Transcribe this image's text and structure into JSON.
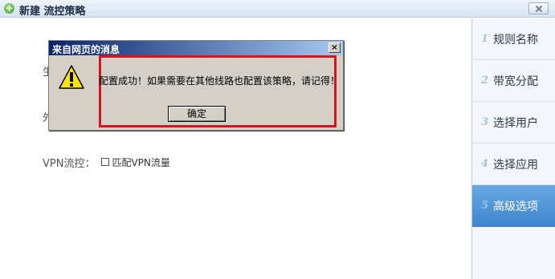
{
  "window": {
    "title": "新建 流控策略",
    "icon": "plus-circle-icon",
    "close_icon": "close-icon"
  },
  "form": {
    "label_1": "生",
    "label_2": "外",
    "vpn_label": "VPN流控：",
    "vpn_checkbox_label": "匹配VPN流量",
    "vpn_checked": false
  },
  "sidebar": {
    "steps": [
      {
        "num": "1",
        "label": "规则名称",
        "active": false
      },
      {
        "num": "2",
        "label": "带宽分配",
        "active": false
      },
      {
        "num": "3",
        "label": "选择用户",
        "active": false
      },
      {
        "num": "4",
        "label": "选择应用",
        "active": false
      },
      {
        "num": "5",
        "label": "高级选项",
        "active": true
      }
    ]
  },
  "dialog": {
    "title": "来自网页的消息",
    "close_label": "×",
    "icon": "warning-icon",
    "message": "配置成功！如果需要在其他线路也配置该策略，请记得！",
    "ok_label": "确定"
  },
  "colors": {
    "highlight": "#d9141e",
    "active_step": "#4a90d9",
    "dialog_bg": "#d4d0c8"
  }
}
